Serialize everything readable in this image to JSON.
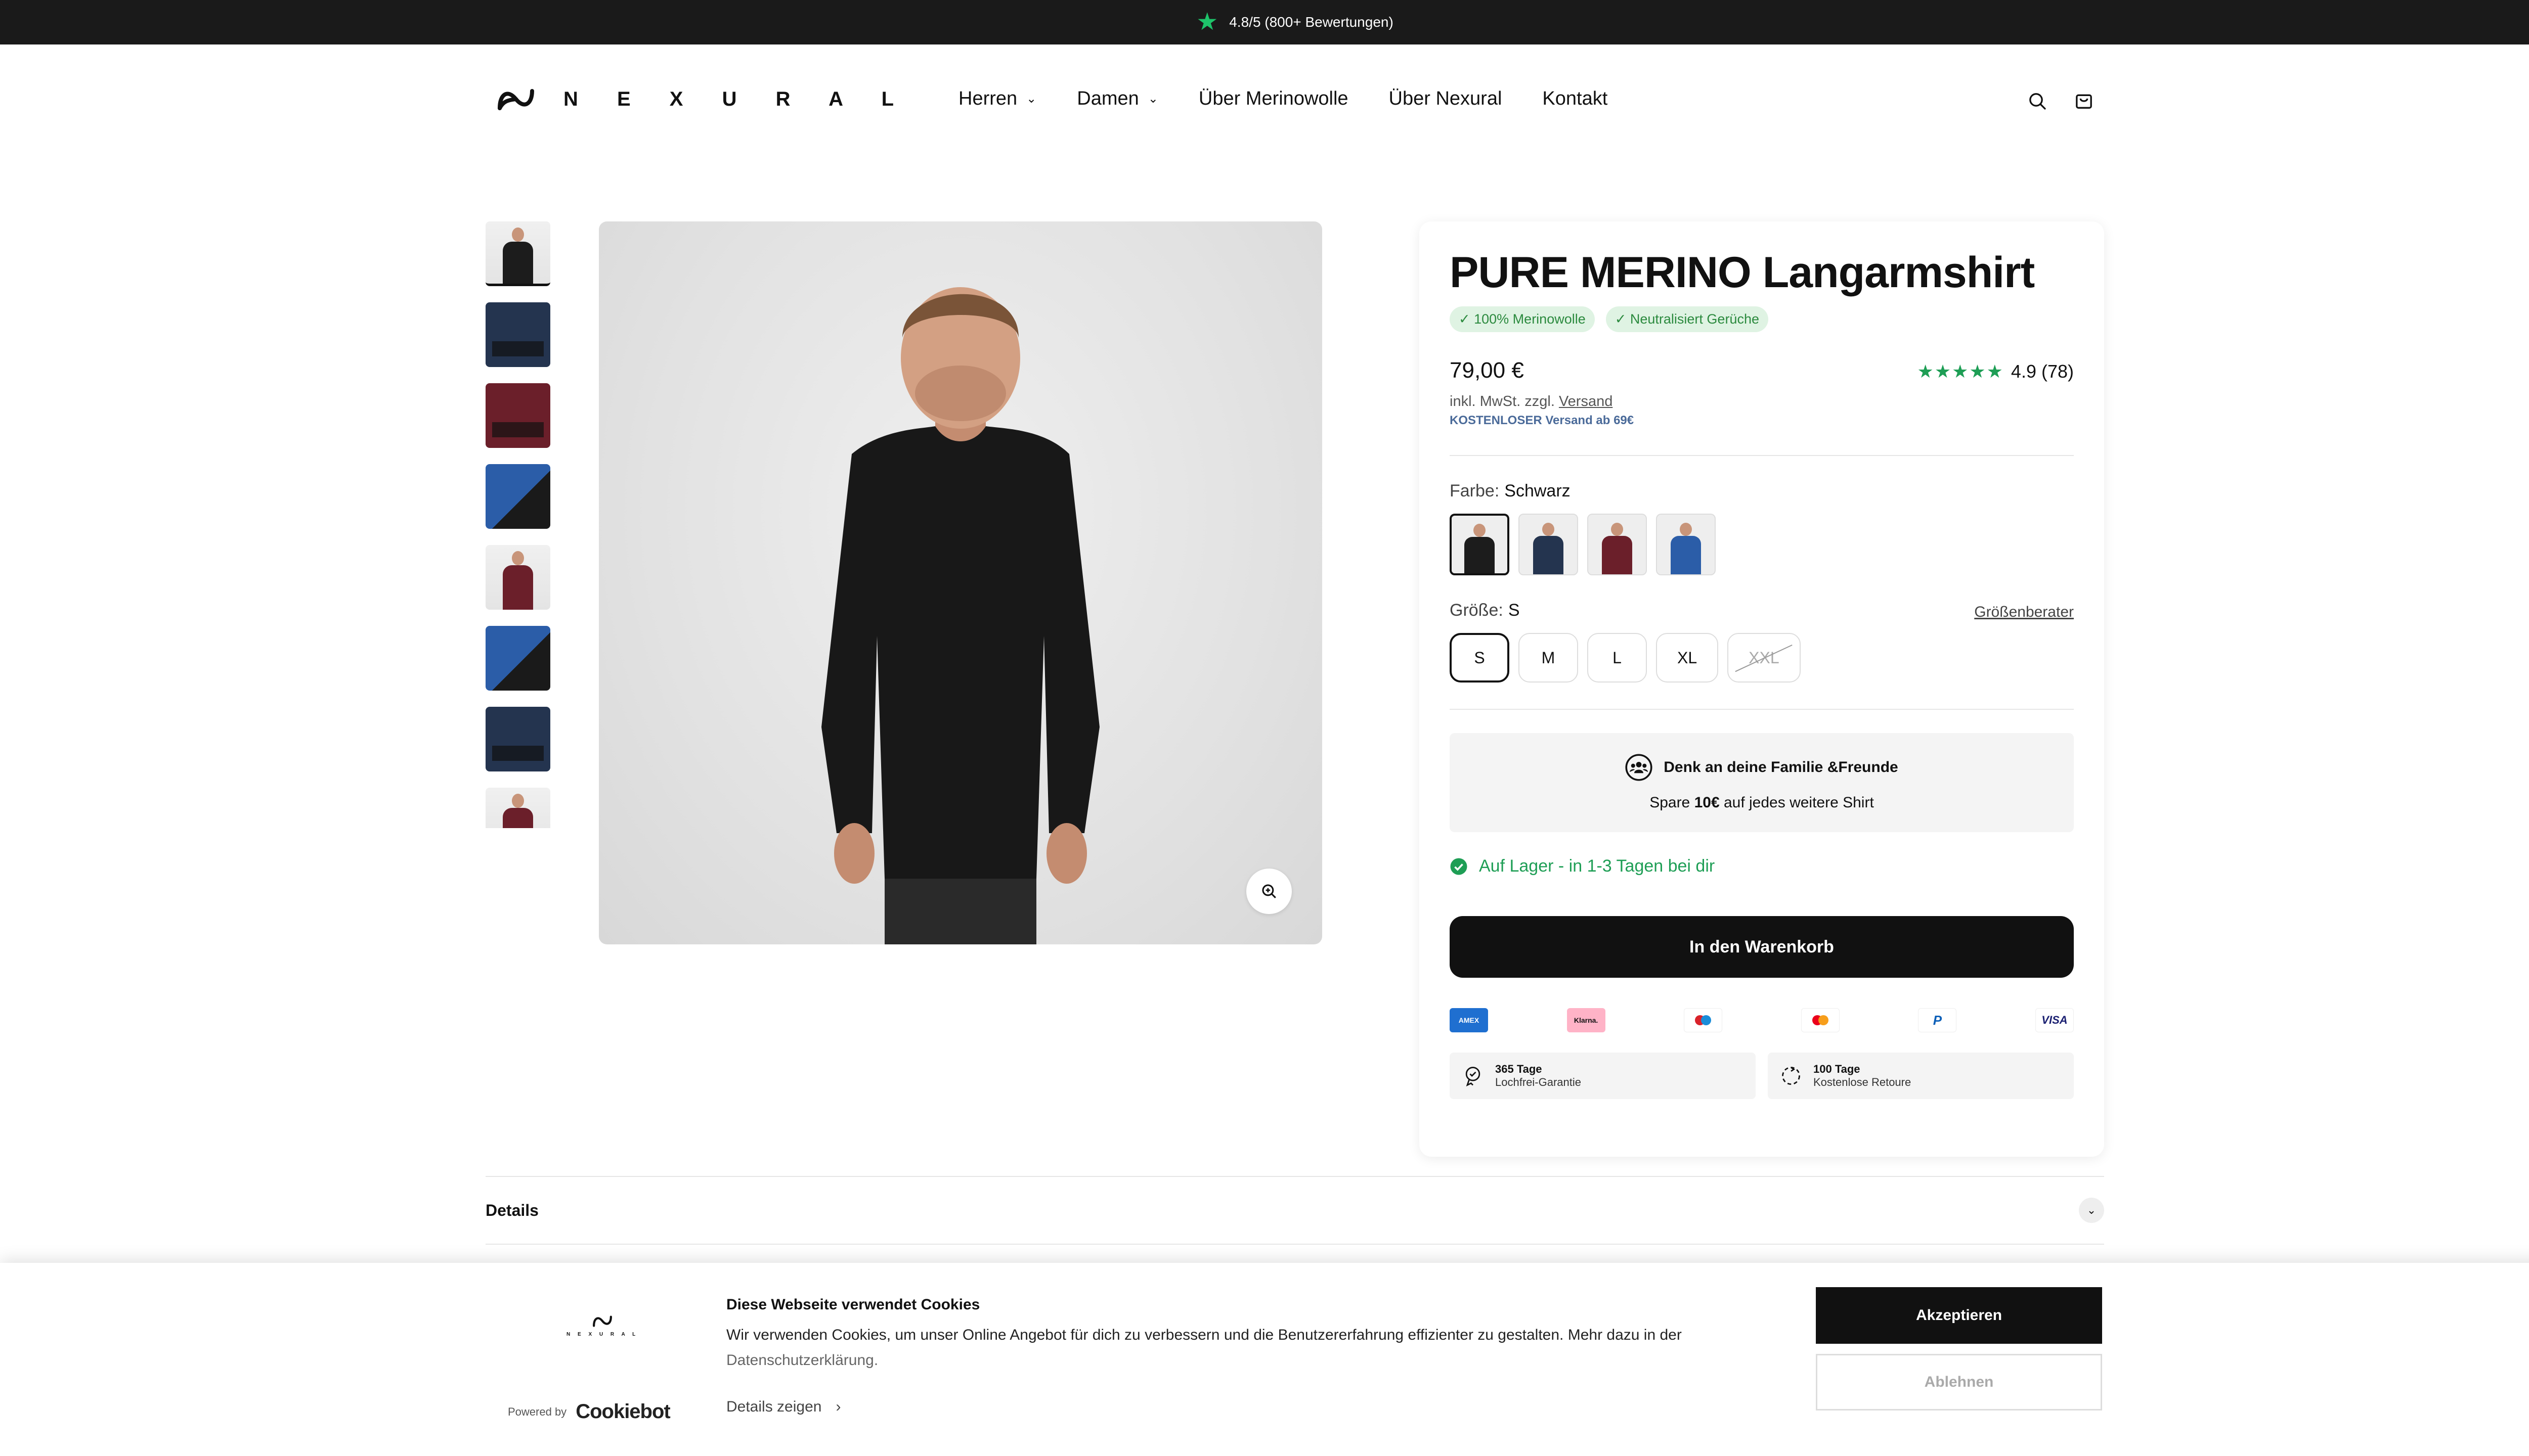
{
  "topbar": {
    "text": "4.8/5 (800+ Bewertungen)",
    "icon": "star-icon",
    "star_color": "#1ec36a"
  },
  "header": {
    "logo_text": "N E X U R A L",
    "nav": [
      {
        "label": "Herren",
        "has_dropdown": true
      },
      {
        "label": "Damen",
        "has_dropdown": true
      },
      {
        "label": "Über Merinowolle",
        "has_dropdown": false
      },
      {
        "label": "Über Nexural",
        "has_dropdown": false
      },
      {
        "label": "Kontakt",
        "has_dropdown": false
      }
    ],
    "icons": [
      "search-icon",
      "cart-icon"
    ]
  },
  "product": {
    "title": "PURE MERINO Langarmshirt",
    "badges": [
      "✓ 100% Merinowolle",
      "✓ Neutralisiert Gerüche"
    ],
    "price": "79,00 €",
    "rating_value": "4.9 (78)",
    "stars": "★★★★★",
    "tax_text": "inkl. MwSt. zzgl. ",
    "tax_link": "Versand",
    "shipping_note": "KOSTENLOSER Versand ab 69€",
    "color_label": "Farbe:",
    "color_value": "Schwarz",
    "colors": [
      {
        "name": "Schwarz",
        "hex": "#1c1c1c",
        "selected": true
      },
      {
        "name": "Navy",
        "hex": "#24344f",
        "selected": false
      },
      {
        "name": "Bordeaux",
        "hex": "#6b1f2a",
        "selected": false
      },
      {
        "name": "Blau",
        "hex": "#2b5da8",
        "selected": false
      }
    ],
    "size_label": "Größe:",
    "size_value": "S",
    "size_guide": "Größenberater",
    "sizes": [
      {
        "label": "S",
        "selected": true,
        "available": true
      },
      {
        "label": "M",
        "selected": false,
        "available": true
      },
      {
        "label": "L",
        "selected": false,
        "available": true
      },
      {
        "label": "XL",
        "selected": false,
        "available": true
      },
      {
        "label": "XXL",
        "selected": false,
        "available": false
      }
    ],
    "promo_title": "Denk an deine Familie &Freunde",
    "promo_pre": "Spare ",
    "promo_bold": "10€",
    "promo_post": " auf jedes weitere Shirt",
    "stock": "Auf Lager - in 1-3 Tagen bei dir",
    "cart_button": "In den Warenkorb",
    "payments": [
      "American Express",
      "Klarna.",
      "Maestro",
      "Mastercard",
      "PayPal",
      "VISA"
    ],
    "guarantees": [
      {
        "title": "365 Tage",
        "subtitle": "Lochfrei-Garantie"
      },
      {
        "title": "100 Tage",
        "subtitle": "Kostenlose Retoure"
      }
    ]
  },
  "gallery": {
    "thumbnails": [
      "black-longsleeve",
      "navy-folded",
      "bordeaux-folded",
      "blue-folded",
      "bordeaux-longsleeve",
      "blue-sleeve",
      "navy-folded-logo",
      "model-partial"
    ]
  },
  "details": {
    "label": "Details"
  },
  "cookie": {
    "title": "Diese Webseite verwendet Cookies",
    "text": "Wir verwenden Cookies, um unser Online Angebot für dich zu verbessern und die Benutzererfahrung effizienter zu gestalten. Mehr dazu in der ",
    "link": "Datenschutzerklärung.",
    "details": "Details zeigen",
    "powered_by": "Powered by",
    "cookiebot": "Cookiebot",
    "accept": "Akzeptieren",
    "decline": "Ablehnen"
  }
}
